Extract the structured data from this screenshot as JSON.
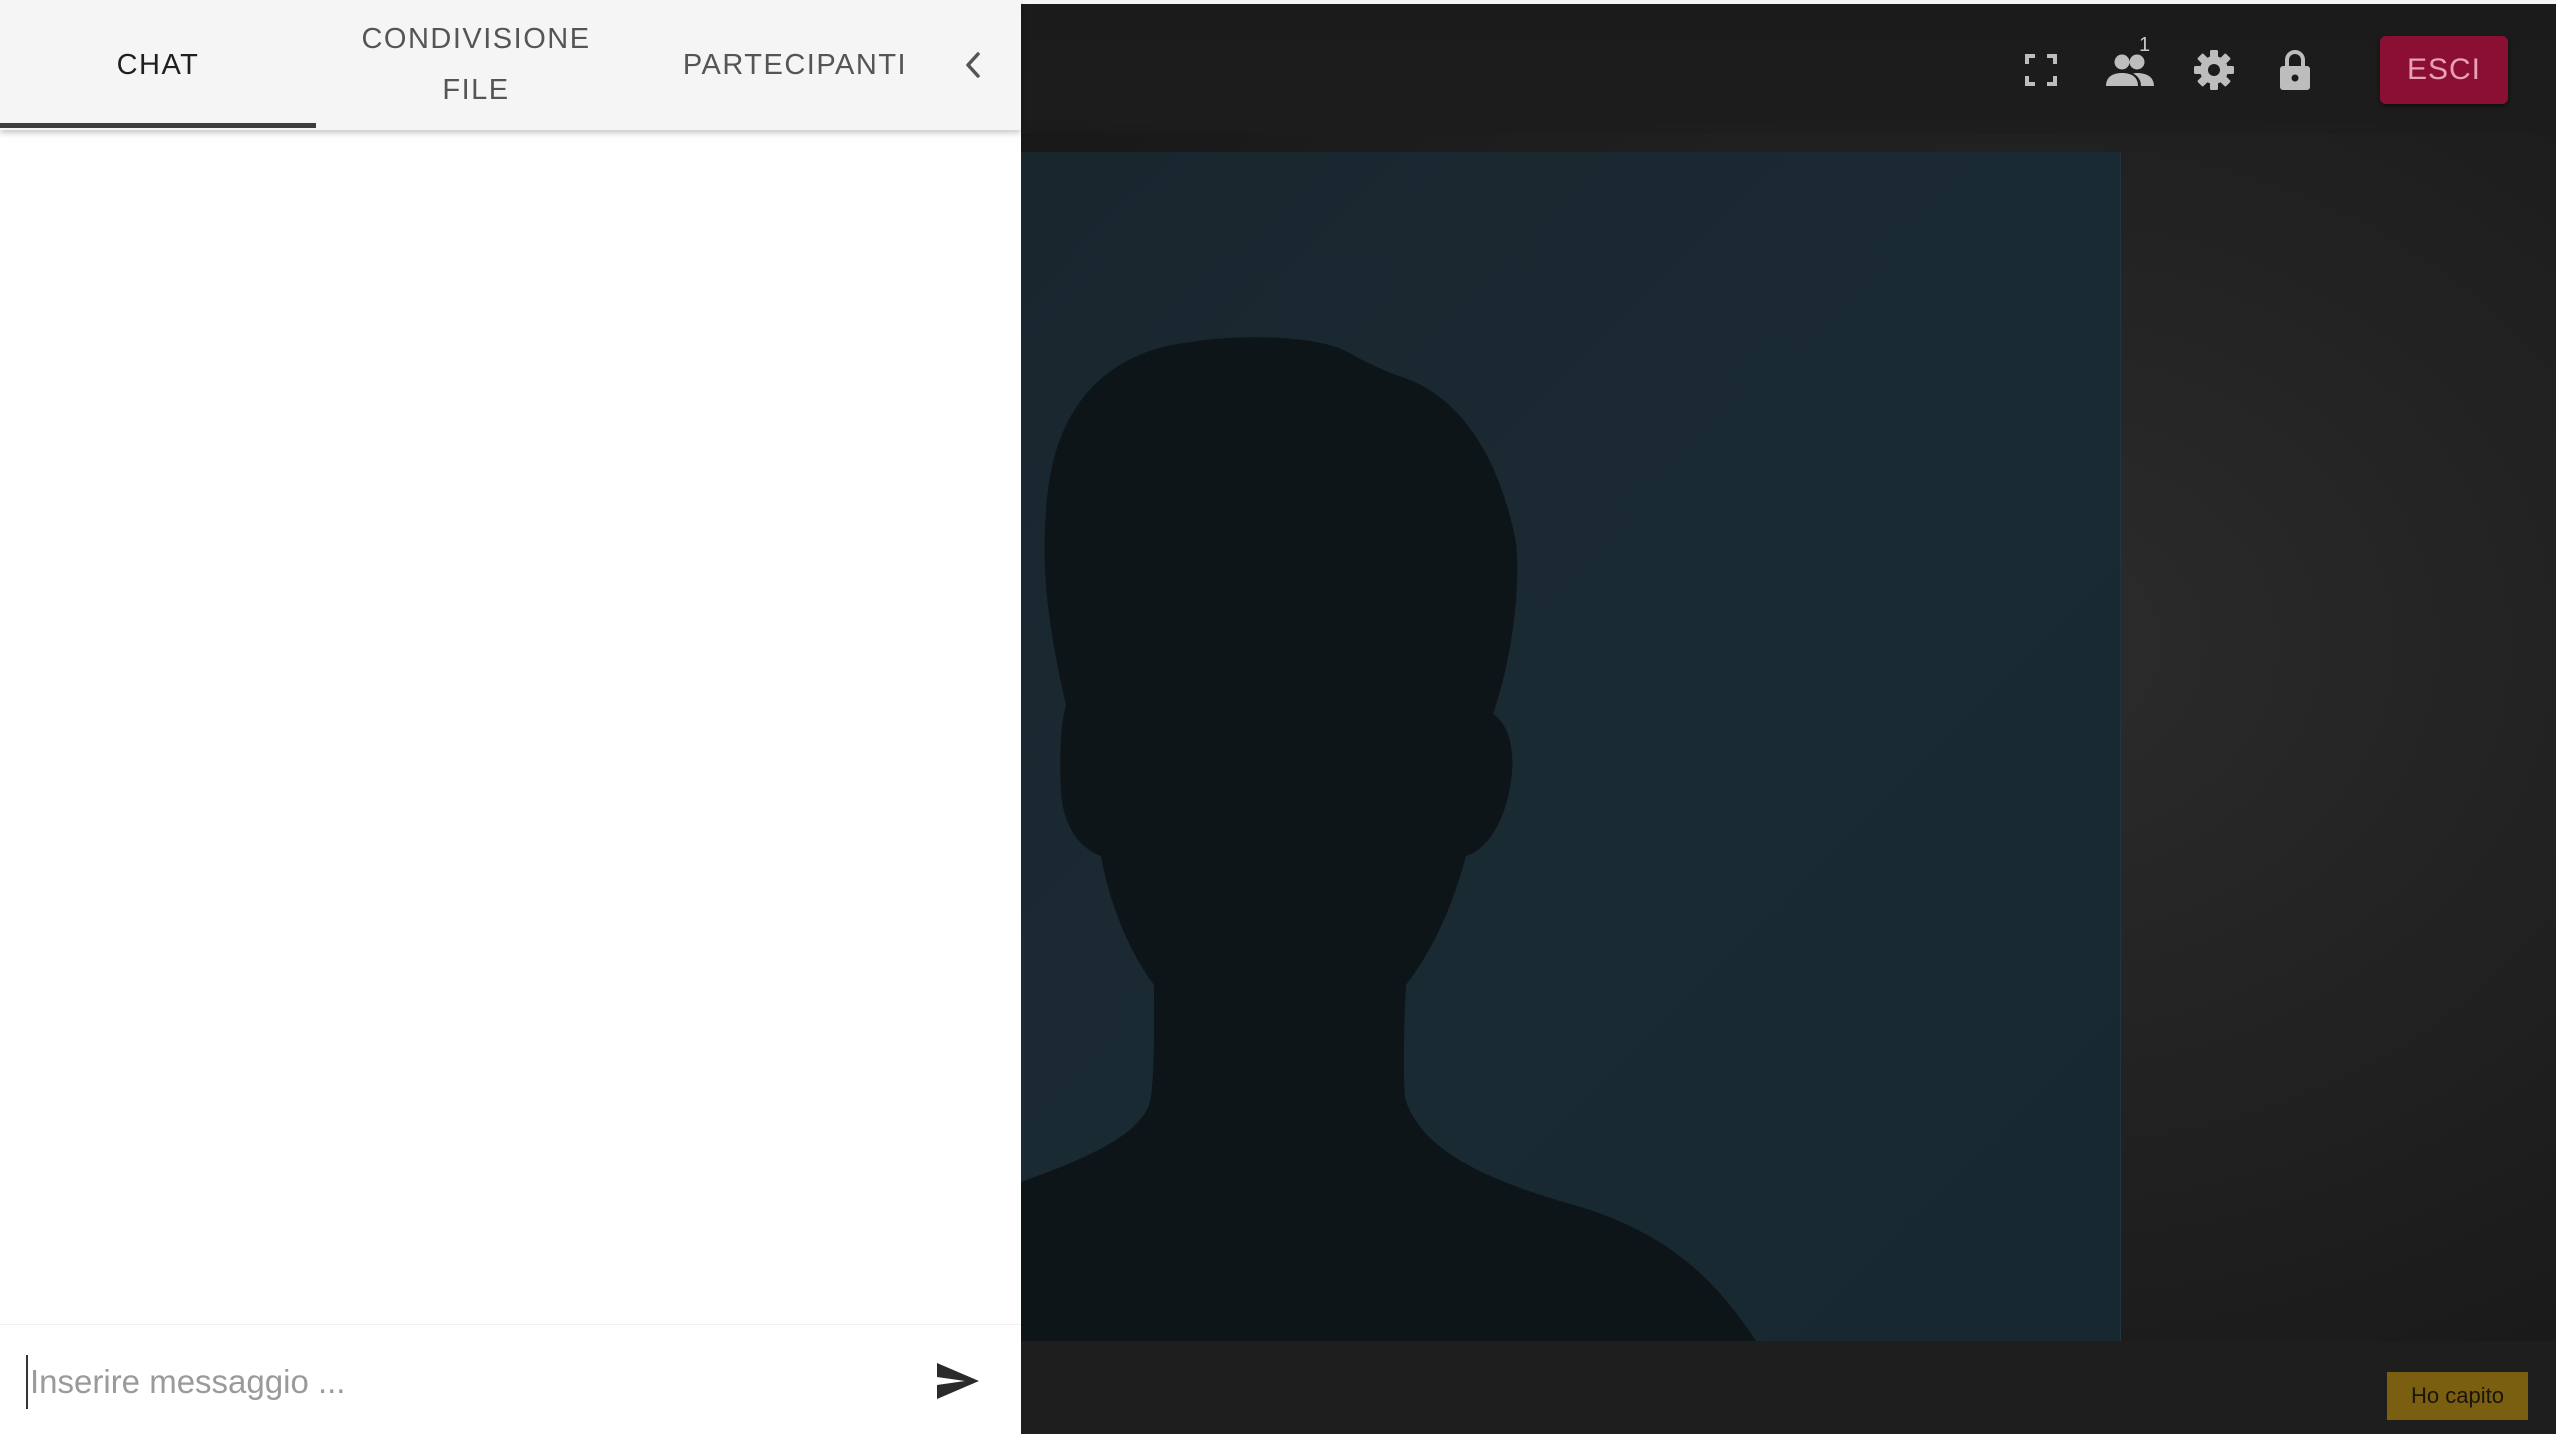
{
  "side_panel": {
    "tabs": [
      {
        "label": "CHAT",
        "active": true
      },
      {
        "label": "CONDIVISIONE FILE",
        "active": false
      },
      {
        "label": "PARTECIPANTI",
        "active": false
      }
    ],
    "collapse_icon": "chevron-left-icon",
    "composer": {
      "placeholder": "Inserire messaggio ...",
      "value": "",
      "send_icon": "send-icon"
    }
  },
  "toolbar": {
    "icons": [
      "fullscreen-icon",
      "participants-icon",
      "settings-icon",
      "lock-icon"
    ],
    "participants_count": "1",
    "exit_label": "ESCI",
    "exit_color": "#8b0f33"
  },
  "video": {
    "placeholder": "avatar-silhouette"
  },
  "notice": {
    "ack_label": "Ho capito",
    "ack_color": "#7a5f10"
  }
}
